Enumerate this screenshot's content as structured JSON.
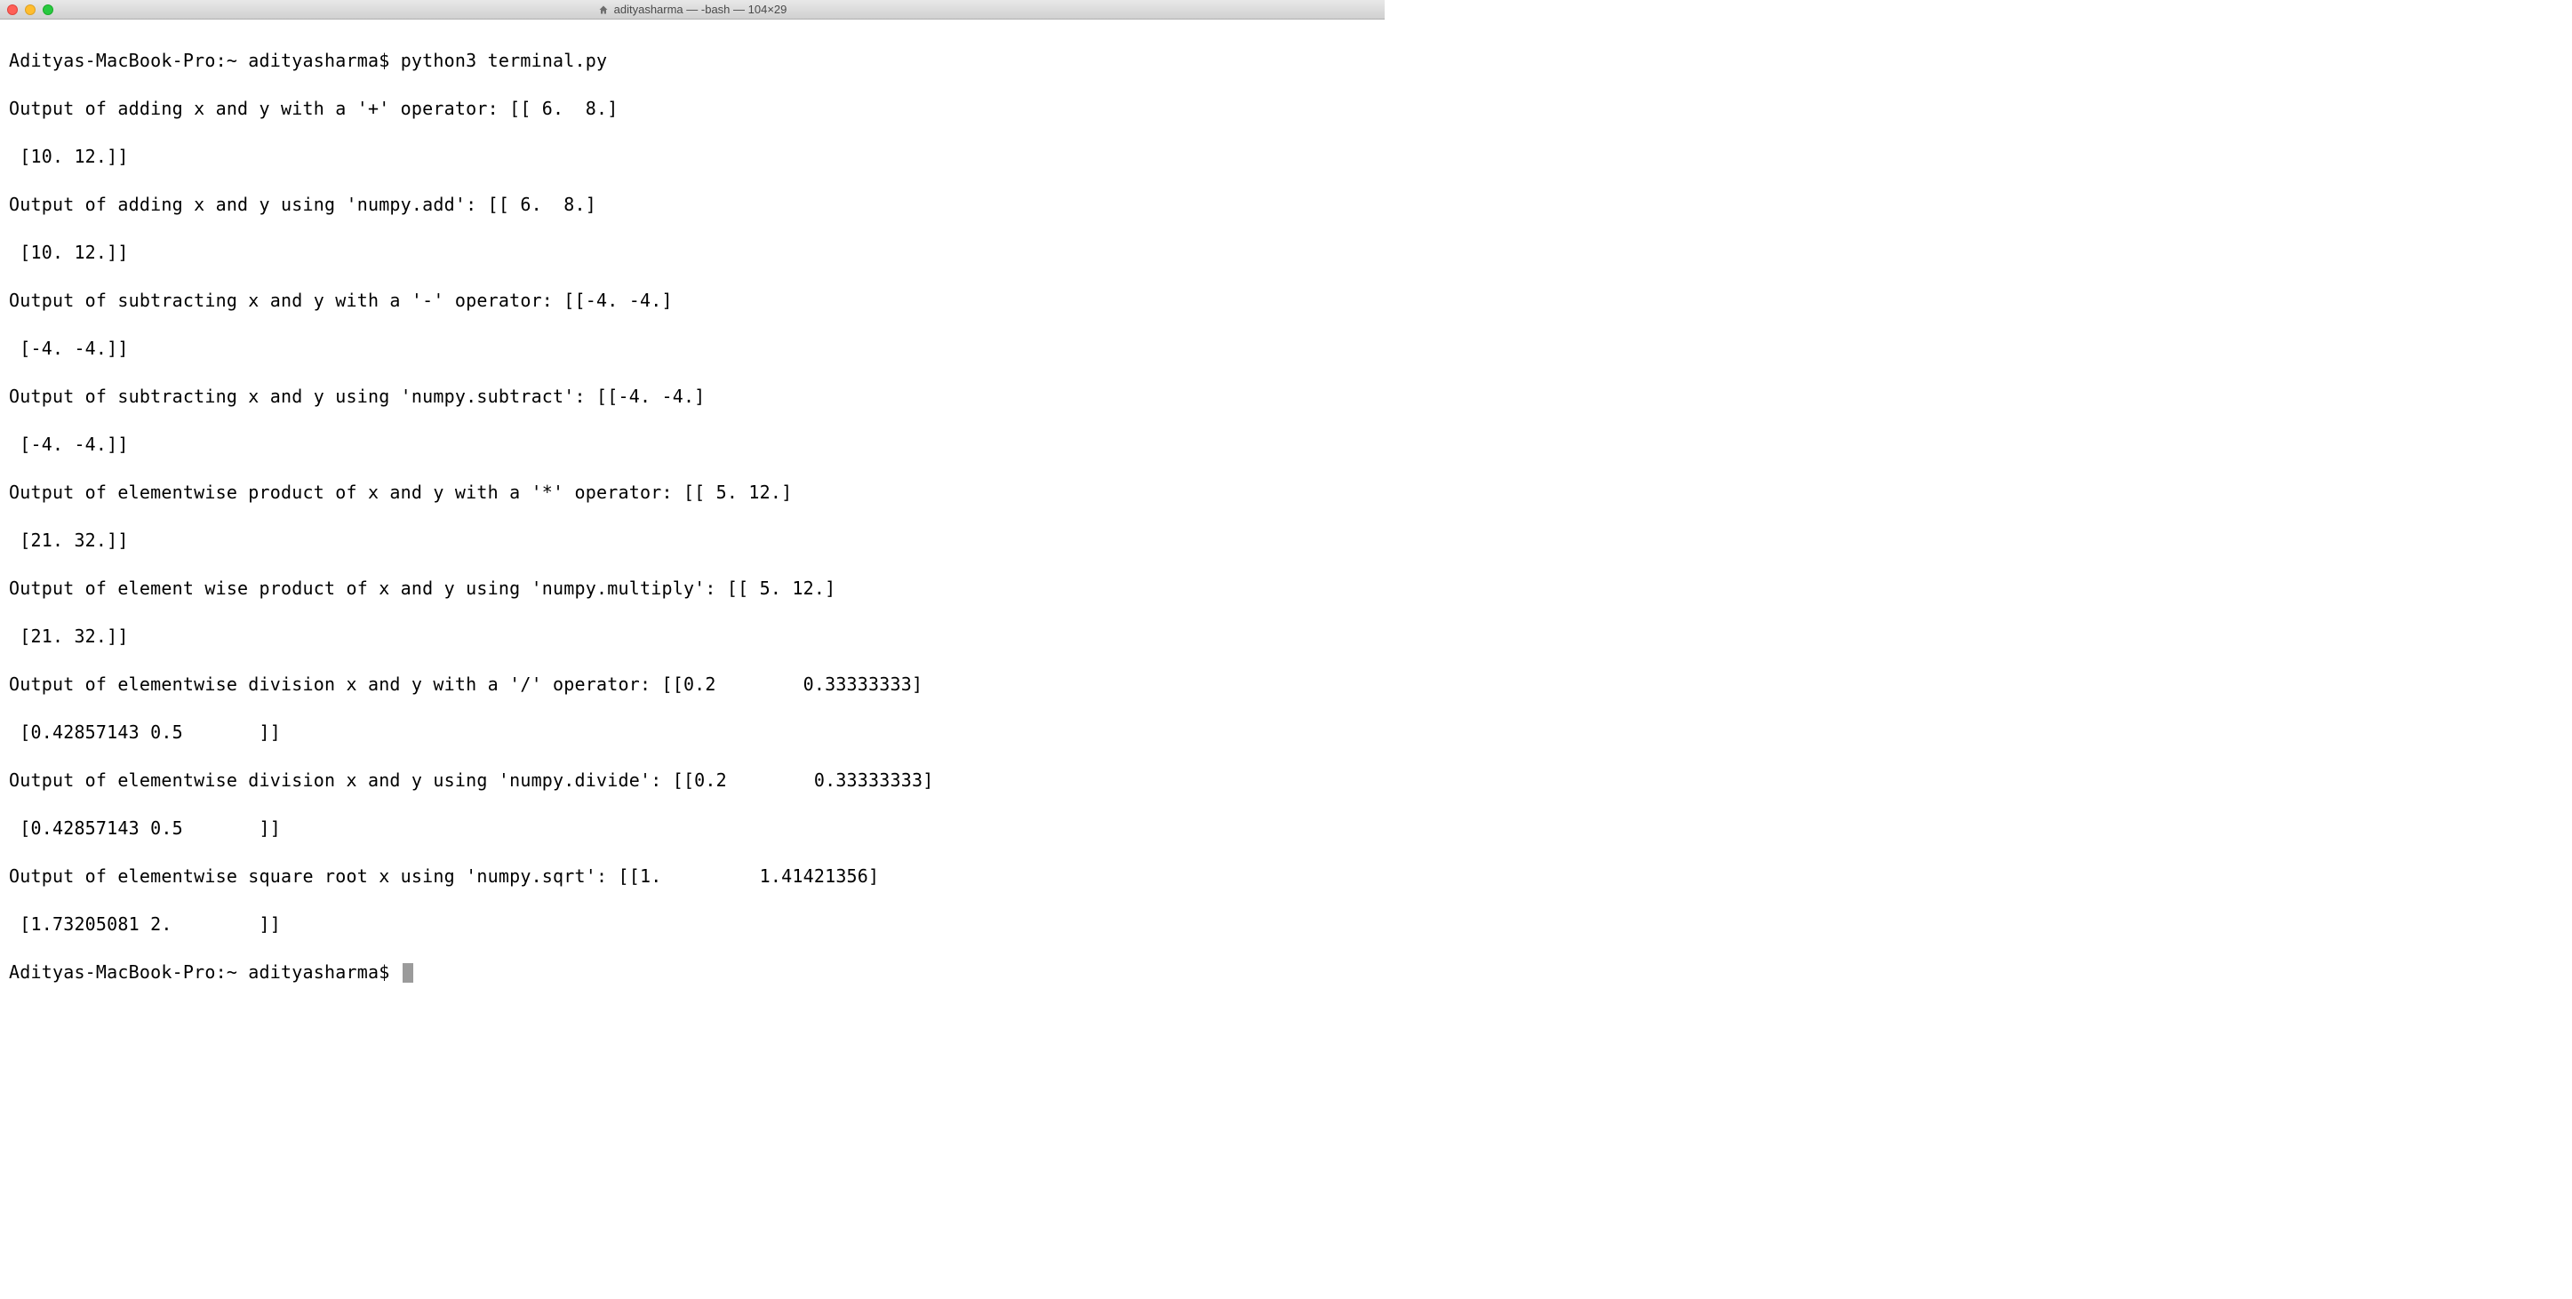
{
  "titlebar": {
    "title": "adityasharma — -bash — 104×29"
  },
  "terminal": {
    "prompt": "Adityas-MacBook-Pro:~ adityasharma$ ",
    "command": "python3 terminal.py",
    "lines": [
      "Output of adding x and y with a '+' operator: [[ 6.  8.]",
      " [10. 12.]]",
      "Output of adding x and y using 'numpy.add': [[ 6.  8.]",
      " [10. 12.]]",
      "Output of subtracting x and y with a '-' operator: [[-4. -4.]",
      " [-4. -4.]]",
      "Output of subtracting x and y using 'numpy.subtract': [[-4. -4.]",
      " [-4. -4.]]",
      "Output of elementwise product of x and y with a '*' operator: [[ 5. 12.]",
      " [21. 32.]]",
      "Output of element wise product of x and y using 'numpy.multiply': [[ 5. 12.]",
      " [21. 32.]]",
      "Output of elementwise division x and y with a '/' operator: [[0.2        0.33333333]",
      " [0.42857143 0.5       ]]",
      "Output of elementwise division x and y using 'numpy.divide': [[0.2        0.33333333]",
      " [0.42857143 0.5       ]]",
      "Output of elementwise square root x using 'numpy.sqrt': [[1.         1.41421356]",
      " [1.73205081 2.        ]]"
    ]
  }
}
